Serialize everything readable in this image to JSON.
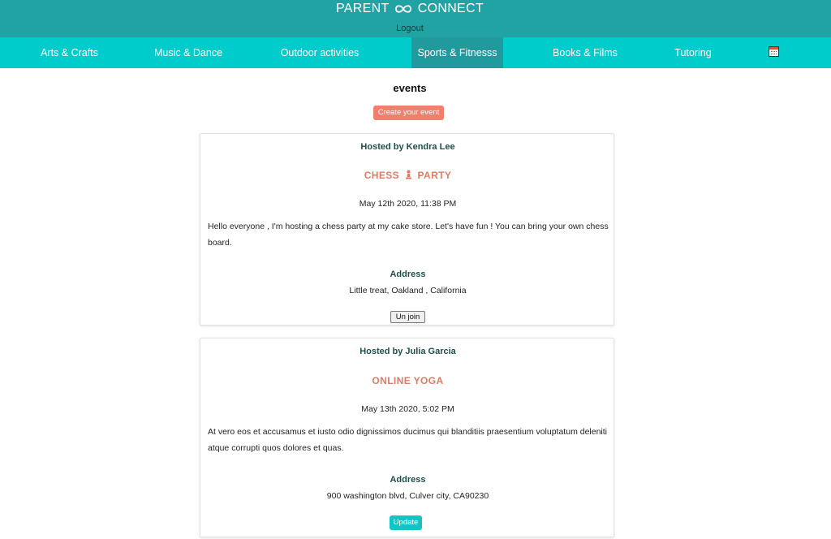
{
  "header": {
    "brand_left": "PARENT",
    "brand_right": "CONNECT",
    "logout_label": "Logout",
    "color": "#22a3a3"
  },
  "nav": {
    "color": "#00cccc",
    "active_color": "#219a9d",
    "items": [
      {
        "label": "Arts & Crafts"
      },
      {
        "label": "Music & Dance"
      },
      {
        "label": "Outdoor activities"
      },
      {
        "label": "Sports & Fitnesss",
        "active": true
      },
      {
        "label": "Books & Films"
      },
      {
        "label": "Tutoring"
      }
    ],
    "calendar_icon": "calendar-icon"
  },
  "main": {
    "title": "events",
    "create_label": "Create your event",
    "create_color": "#f07f6c"
  },
  "events": [
    {
      "host": "Hosted by Kendra Lee",
      "title_left": "CHESS",
      "title_icon": "chess-pawn-icon",
      "title_right": "PARTY",
      "date": "May 12th 2020, 11:38 PM",
      "description": "Hello everyone , I'm hosting a chess party at my cake store. Let's have fun ! You can bring your own chessboard.",
      "address_label": "Address",
      "address": "Little treat, Oakland , California",
      "action_label": "Un join"
    },
    {
      "host": "Hosted by Julia Garcia",
      "title": "ONLINE YOGA",
      "date": "May 13th 2020, 5:02 PM",
      "description": "At vero eos et accusamus et iusto odio dignissimos ducimus qui blanditiis praesentium voluptatum deleniti atque corrupti quos dolores et quas.",
      "address_label": "Address",
      "address": "900 washington blvd, Culver city, CA90230",
      "action_label": "Update",
      "action_color": "#12c4c4"
    }
  ]
}
